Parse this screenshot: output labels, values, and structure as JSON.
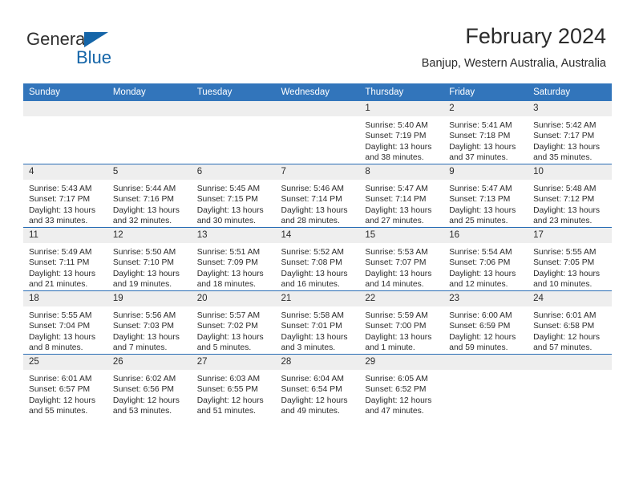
{
  "brand": {
    "name_part1": "General",
    "name_part2": "Blue",
    "triangle_color": "#1565a8"
  },
  "header": {
    "title": "February 2024",
    "subtitle": "Banjup, Western Australia, Australia"
  },
  "theme": {
    "header_bg": "#3275bb",
    "row_divider": "#2a6db5",
    "daynum_bg": "#eeeeee",
    "text": "#2b2b2b"
  },
  "weekdays": [
    "Sunday",
    "Monday",
    "Tuesday",
    "Wednesday",
    "Thursday",
    "Friday",
    "Saturday"
  ],
  "weeks": [
    [
      {
        "day": "",
        "sunrise": "",
        "sunset": "",
        "daylight_1": "",
        "daylight_2": ""
      },
      {
        "day": "",
        "sunrise": "",
        "sunset": "",
        "daylight_1": "",
        "daylight_2": ""
      },
      {
        "day": "",
        "sunrise": "",
        "sunset": "",
        "daylight_1": "",
        "daylight_2": ""
      },
      {
        "day": "",
        "sunrise": "",
        "sunset": "",
        "daylight_1": "",
        "daylight_2": ""
      },
      {
        "day": "1",
        "sunrise": "Sunrise: 5:40 AM",
        "sunset": "Sunset: 7:19 PM",
        "daylight_1": "Daylight: 13 hours",
        "daylight_2": "and 38 minutes."
      },
      {
        "day": "2",
        "sunrise": "Sunrise: 5:41 AM",
        "sunset": "Sunset: 7:18 PM",
        "daylight_1": "Daylight: 13 hours",
        "daylight_2": "and 37 minutes."
      },
      {
        "day": "3",
        "sunrise": "Sunrise: 5:42 AM",
        "sunset": "Sunset: 7:17 PM",
        "daylight_1": "Daylight: 13 hours",
        "daylight_2": "and 35 minutes."
      }
    ],
    [
      {
        "day": "4",
        "sunrise": "Sunrise: 5:43 AM",
        "sunset": "Sunset: 7:17 PM",
        "daylight_1": "Daylight: 13 hours",
        "daylight_2": "and 33 minutes."
      },
      {
        "day": "5",
        "sunrise": "Sunrise: 5:44 AM",
        "sunset": "Sunset: 7:16 PM",
        "daylight_1": "Daylight: 13 hours",
        "daylight_2": "and 32 minutes."
      },
      {
        "day": "6",
        "sunrise": "Sunrise: 5:45 AM",
        "sunset": "Sunset: 7:15 PM",
        "daylight_1": "Daylight: 13 hours",
        "daylight_2": "and 30 minutes."
      },
      {
        "day": "7",
        "sunrise": "Sunrise: 5:46 AM",
        "sunset": "Sunset: 7:14 PM",
        "daylight_1": "Daylight: 13 hours",
        "daylight_2": "and 28 minutes."
      },
      {
        "day": "8",
        "sunrise": "Sunrise: 5:47 AM",
        "sunset": "Sunset: 7:14 PM",
        "daylight_1": "Daylight: 13 hours",
        "daylight_2": "and 27 minutes."
      },
      {
        "day": "9",
        "sunrise": "Sunrise: 5:47 AM",
        "sunset": "Sunset: 7:13 PM",
        "daylight_1": "Daylight: 13 hours",
        "daylight_2": "and 25 minutes."
      },
      {
        "day": "10",
        "sunrise": "Sunrise: 5:48 AM",
        "sunset": "Sunset: 7:12 PM",
        "daylight_1": "Daylight: 13 hours",
        "daylight_2": "and 23 minutes."
      }
    ],
    [
      {
        "day": "11",
        "sunrise": "Sunrise: 5:49 AM",
        "sunset": "Sunset: 7:11 PM",
        "daylight_1": "Daylight: 13 hours",
        "daylight_2": "and 21 minutes."
      },
      {
        "day": "12",
        "sunrise": "Sunrise: 5:50 AM",
        "sunset": "Sunset: 7:10 PM",
        "daylight_1": "Daylight: 13 hours",
        "daylight_2": "and 19 minutes."
      },
      {
        "day": "13",
        "sunrise": "Sunrise: 5:51 AM",
        "sunset": "Sunset: 7:09 PM",
        "daylight_1": "Daylight: 13 hours",
        "daylight_2": "and 18 minutes."
      },
      {
        "day": "14",
        "sunrise": "Sunrise: 5:52 AM",
        "sunset": "Sunset: 7:08 PM",
        "daylight_1": "Daylight: 13 hours",
        "daylight_2": "and 16 minutes."
      },
      {
        "day": "15",
        "sunrise": "Sunrise: 5:53 AM",
        "sunset": "Sunset: 7:07 PM",
        "daylight_1": "Daylight: 13 hours",
        "daylight_2": "and 14 minutes."
      },
      {
        "day": "16",
        "sunrise": "Sunrise: 5:54 AM",
        "sunset": "Sunset: 7:06 PM",
        "daylight_1": "Daylight: 13 hours",
        "daylight_2": "and 12 minutes."
      },
      {
        "day": "17",
        "sunrise": "Sunrise: 5:55 AM",
        "sunset": "Sunset: 7:05 PM",
        "daylight_1": "Daylight: 13 hours",
        "daylight_2": "and 10 minutes."
      }
    ],
    [
      {
        "day": "18",
        "sunrise": "Sunrise: 5:55 AM",
        "sunset": "Sunset: 7:04 PM",
        "daylight_1": "Daylight: 13 hours",
        "daylight_2": "and 8 minutes."
      },
      {
        "day": "19",
        "sunrise": "Sunrise: 5:56 AM",
        "sunset": "Sunset: 7:03 PM",
        "daylight_1": "Daylight: 13 hours",
        "daylight_2": "and 7 minutes."
      },
      {
        "day": "20",
        "sunrise": "Sunrise: 5:57 AM",
        "sunset": "Sunset: 7:02 PM",
        "daylight_1": "Daylight: 13 hours",
        "daylight_2": "and 5 minutes."
      },
      {
        "day": "21",
        "sunrise": "Sunrise: 5:58 AM",
        "sunset": "Sunset: 7:01 PM",
        "daylight_1": "Daylight: 13 hours",
        "daylight_2": "and 3 minutes."
      },
      {
        "day": "22",
        "sunrise": "Sunrise: 5:59 AM",
        "sunset": "Sunset: 7:00 PM",
        "daylight_1": "Daylight: 13 hours",
        "daylight_2": "and 1 minute."
      },
      {
        "day": "23",
        "sunrise": "Sunrise: 6:00 AM",
        "sunset": "Sunset: 6:59 PM",
        "daylight_1": "Daylight: 12 hours",
        "daylight_2": "and 59 minutes."
      },
      {
        "day": "24",
        "sunrise": "Sunrise: 6:01 AM",
        "sunset": "Sunset: 6:58 PM",
        "daylight_1": "Daylight: 12 hours",
        "daylight_2": "and 57 minutes."
      }
    ],
    [
      {
        "day": "25",
        "sunrise": "Sunrise: 6:01 AM",
        "sunset": "Sunset: 6:57 PM",
        "daylight_1": "Daylight: 12 hours",
        "daylight_2": "and 55 minutes."
      },
      {
        "day": "26",
        "sunrise": "Sunrise: 6:02 AM",
        "sunset": "Sunset: 6:56 PM",
        "daylight_1": "Daylight: 12 hours",
        "daylight_2": "and 53 minutes."
      },
      {
        "day": "27",
        "sunrise": "Sunrise: 6:03 AM",
        "sunset": "Sunset: 6:55 PM",
        "daylight_1": "Daylight: 12 hours",
        "daylight_2": "and 51 minutes."
      },
      {
        "day": "28",
        "sunrise": "Sunrise: 6:04 AM",
        "sunset": "Sunset: 6:54 PM",
        "daylight_1": "Daylight: 12 hours",
        "daylight_2": "and 49 minutes."
      },
      {
        "day": "29",
        "sunrise": "Sunrise: 6:05 AM",
        "sunset": "Sunset: 6:52 PM",
        "daylight_1": "Daylight: 12 hours",
        "daylight_2": "and 47 minutes."
      },
      {
        "day": "",
        "sunrise": "",
        "sunset": "",
        "daylight_1": "",
        "daylight_2": ""
      },
      {
        "day": "",
        "sunrise": "",
        "sunset": "",
        "daylight_1": "",
        "daylight_2": ""
      }
    ]
  ]
}
